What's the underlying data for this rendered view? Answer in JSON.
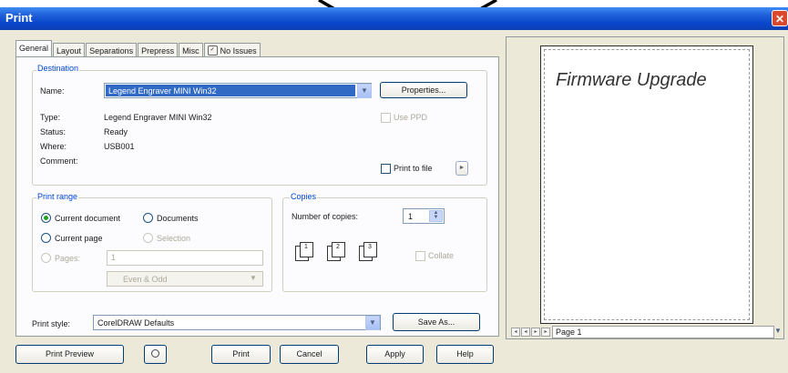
{
  "window": {
    "title": "Print",
    "close_glyph": "✕"
  },
  "tabs": [
    "General",
    "Layout",
    "Separations",
    "Prepress",
    "Misc",
    "No Issues"
  ],
  "destination": {
    "group_label": "Destination",
    "name_label": "Name:",
    "name_value": "Legend Engraver MINI Win32",
    "properties_label": "Properties...",
    "type_label": "Type:",
    "type_value": "Legend Engraver MINI Win32",
    "status_label": "Status:",
    "status_value": "Ready",
    "where_label": "Where:",
    "where_value": "USB001",
    "comment_label": "Comment:",
    "use_ppd_label": "Use PPD",
    "print_to_file_label": "Print to file"
  },
  "print_range": {
    "group_label": "Print range",
    "current_document": "Current document",
    "documents": "Documents",
    "current_page": "Current page",
    "selection": "Selection",
    "pages": "Pages:",
    "pages_value": "1",
    "even_odd": "Even & Odd"
  },
  "copies": {
    "group_label": "Copies",
    "number_label": "Number of copies:",
    "number_value": "1",
    "collate_label": "Collate"
  },
  "print_style": {
    "label": "Print style:",
    "value": "CorelDRAW Defaults",
    "save_as_label": "Save As..."
  },
  "bottom_buttons": {
    "print_preview": "Print Preview",
    "print": "Print",
    "cancel": "Cancel",
    "apply": "Apply",
    "help": "Help"
  },
  "preview": {
    "page_text": "Firmware Upgrade",
    "page_label": "Page 1"
  }
}
